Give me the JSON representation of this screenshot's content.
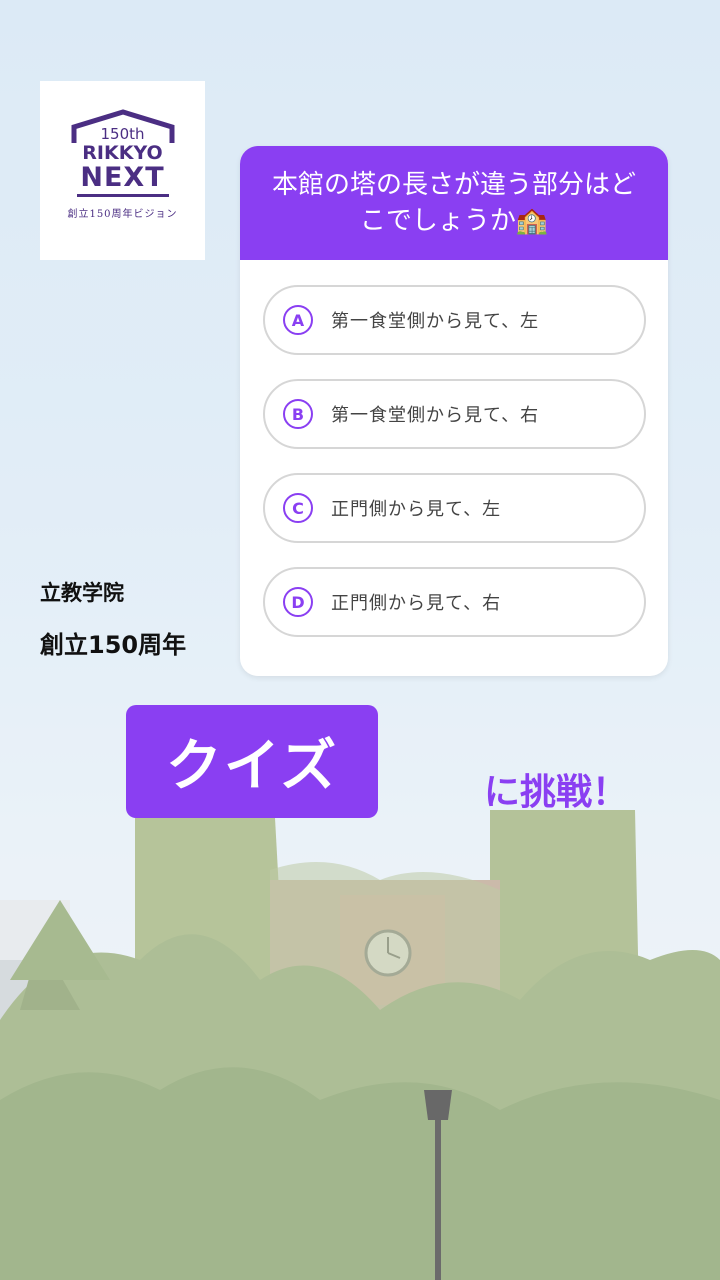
{
  "logo": {
    "line1": "150th",
    "line2": "RIKKYO",
    "line3": "NEXT",
    "sub": "創立150周年ビジョン"
  },
  "quiz": {
    "question": "本館の塔の長さが違う部分はどこでしょうか🏫",
    "options": [
      {
        "letter": "A",
        "text": "第一食堂側から見て、左"
      },
      {
        "letter": "B",
        "text": "第一食堂側から見て、右"
      },
      {
        "letter": "C",
        "text": "正門側から見て、左"
      },
      {
        "letter": "D",
        "text": "正門側から見て、右"
      }
    ]
  },
  "side": {
    "line1": "立教学院",
    "line2": "創立150周年"
  },
  "tag": {
    "label": "クイズ",
    "suffix": "に挑戦！"
  },
  "colors": {
    "accent": "#8a3ff2",
    "logo": "#4b2e83"
  },
  "icons": {
    "building": "building-icon",
    "clock": "clock-icon"
  }
}
